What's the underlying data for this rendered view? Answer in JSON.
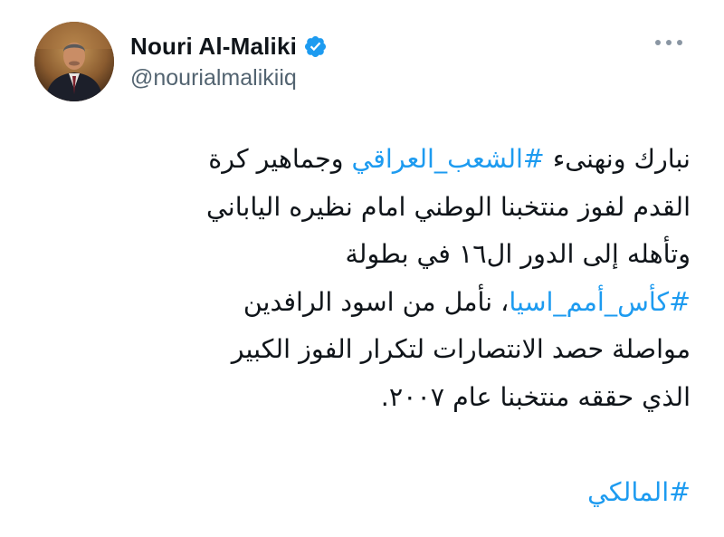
{
  "author": {
    "display_name": "Nouri Al-Maliki",
    "handle": "@nourialmalikiiq",
    "verified": true,
    "avatar_icon": "profile-photo"
  },
  "menu": {
    "icon": "more-horizontal-icon"
  },
  "tweet": {
    "lines": [
      [
        {
          "text": "نبارك ونهنىء ",
          "type": "text"
        },
        {
          "text": "#الشعب_العراقي",
          "type": "hashtag"
        },
        {
          "text": " وجماهير كرة",
          "type": "text"
        }
      ],
      [
        {
          "text": "القدم لفوز منتخبنا الوطني امام نظيره الياباني",
          "type": "text"
        }
      ],
      [
        {
          "text": "وتأهله إلى الدور ال١٦ في بطولة",
          "type": "text"
        }
      ],
      [
        {
          "text": "#كأس_أمم_اسيا",
          "type": "hashtag"
        },
        {
          "text": "، نأمل من اسود الرافدين",
          "type": "text"
        }
      ],
      [
        {
          "text": "مواصلة حصد الانتصارات لتكرار الفوز الكبير",
          "type": "text"
        }
      ],
      [
        {
          "text": "الذي حققه منتخبنا عام ٢٠٠٧.",
          "type": "text"
        }
      ],
      [
        {
          "text": "",
          "type": "text"
        }
      ],
      [
        {
          "text": "#المالكي",
          "type": "hashtag"
        }
      ]
    ]
  },
  "colors": {
    "text": "#0f1419",
    "secondary": "#536471",
    "link": "#1d9bf0",
    "verified": "#1d9bf0"
  }
}
